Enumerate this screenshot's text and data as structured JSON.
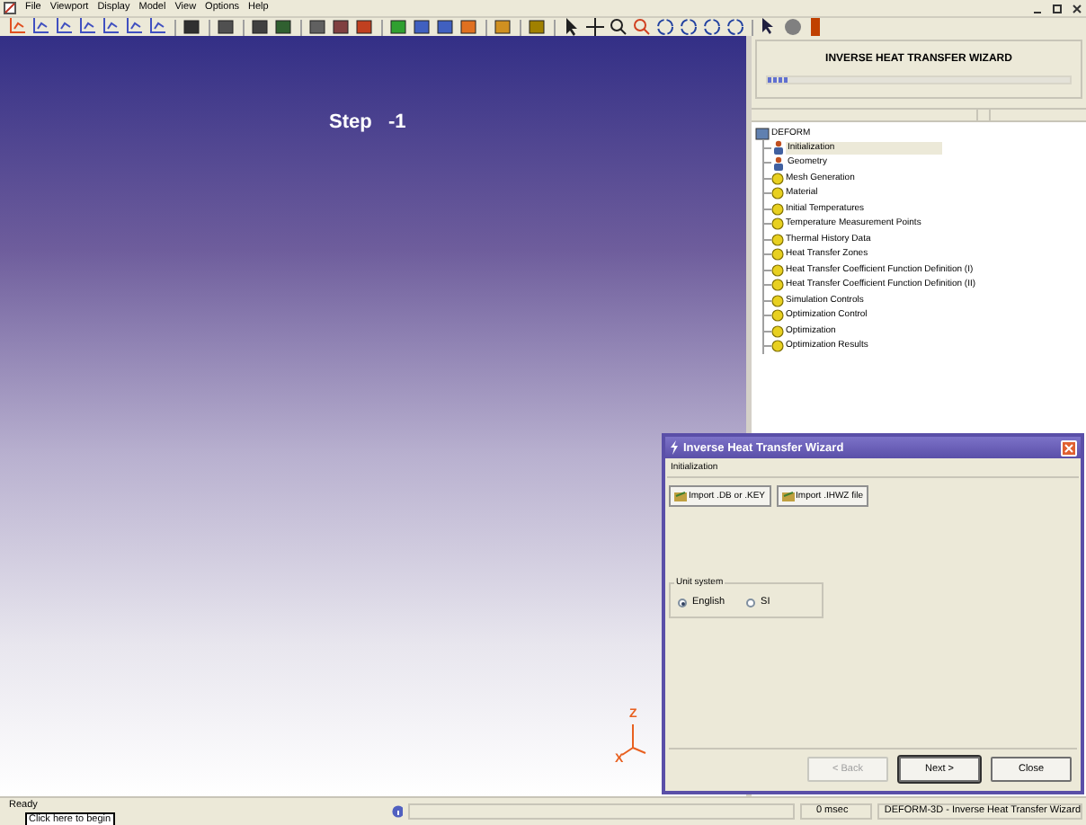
{
  "menu": [
    "File",
    "Viewport",
    "Display",
    "Model",
    "View",
    "Options",
    "Help"
  ],
  "viewport": {
    "step_label": "Step   -1",
    "axis_z": "Z",
    "axis_x": "X"
  },
  "wizard_panel": {
    "title": "INVERSE HEAT TRANSFER WIZARD",
    "progress": {
      "level": 0.07
    }
  },
  "tree": {
    "label": "DEFORM",
    "children": [
      {
        "label": "Initialization",
        "kind": "figure",
        "selected": true
      },
      {
        "label": "Geometry",
        "kind": "figure",
        "selected": false
      },
      {
        "label": "Mesh Generation",
        "kind": "pending",
        "selected": false
      },
      {
        "label": "Material",
        "kind": "pending",
        "selected": false
      },
      {
        "label": "Initial Temperatures",
        "kind": "pending",
        "selected": false
      },
      {
        "label": "Temperature Measurement Points",
        "kind": "pending",
        "selected": false
      },
      {
        "label": "Thermal History Data",
        "kind": "pending",
        "selected": false
      },
      {
        "label": "Heat Transfer Zones",
        "kind": "pending",
        "selected": false
      },
      {
        "label": "Heat Transfer Coefficient Function Definition (I)",
        "kind": "pending",
        "selected": false
      },
      {
        "label": "Heat Transfer Coefficient Function Definition (II)",
        "kind": "pending",
        "selected": false
      },
      {
        "label": "Simulation Controls",
        "kind": "pending",
        "selected": false
      },
      {
        "label": "Optimization Control",
        "kind": "pending",
        "selected": false
      },
      {
        "label": "Optimization",
        "kind": "pending",
        "selected": false
      },
      {
        "label": "Optimization Results",
        "kind": "pending",
        "selected": false
      }
    ]
  },
  "dialog": {
    "title": "Inverse Heat Transfer Wizard",
    "section": "Initialization",
    "import_buttons": [
      "Import .DB or .KEY",
      "Import .IHWZ file"
    ],
    "unit_group": {
      "label": "Unit system",
      "options": [
        {
          "label": "English",
          "selected": true
        },
        {
          "label": "SI",
          "selected": false
        }
      ]
    },
    "buttons": [
      {
        "label": "< Back",
        "disabled": true,
        "default": false
      },
      {
        "label": "Next >",
        "disabled": false,
        "default": true
      },
      {
        "label": "Close",
        "disabled": false,
        "default": false
      }
    ]
  },
  "status_bar": {
    "text": "Ready",
    "tooltip": "Click here to begin",
    "time": "0 msec",
    "app": "DEFORM-3D  -  Inverse Heat Transfer Wizard"
  }
}
